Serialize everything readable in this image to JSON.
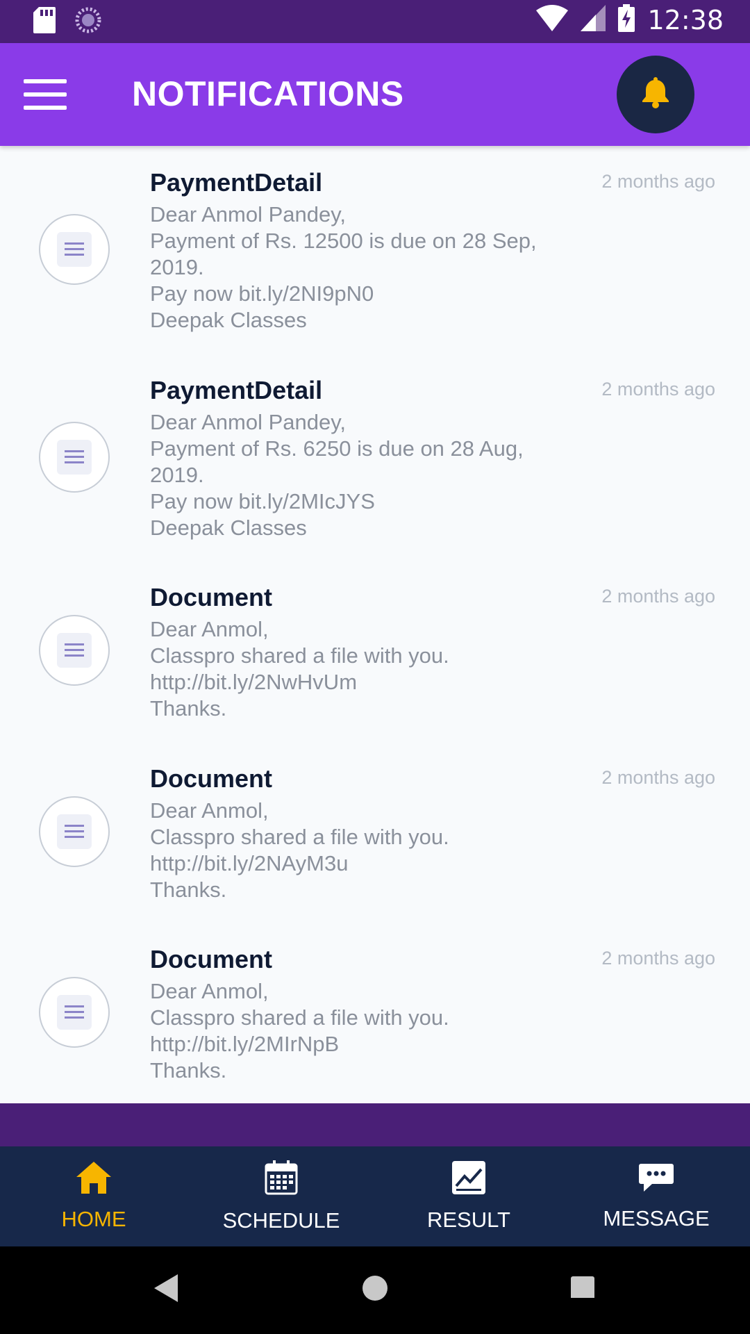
{
  "status_bar": {
    "time": "12:38"
  },
  "app_bar": {
    "title": "NOTIFICATIONS"
  },
  "notifications": [
    {
      "title": "PaymentDetail",
      "time": "2 months ago",
      "body": "Dear Anmol Pandey,\nPayment of Rs. 12500 is due on 28 Sep,\n2019.\nPay now bit.ly/2NI9pN0\nDeepak Classes"
    },
    {
      "title": "PaymentDetail",
      "time": "2 months ago",
      "body": "Dear Anmol Pandey,\nPayment of Rs. 6250 is due on 28 Aug,\n2019.\nPay now bit.ly/2MIcJYS\nDeepak Classes"
    },
    {
      "title": "Document",
      "time": "2 months ago",
      "body": "Dear Anmol,\nClasspro shared a file with you.\nhttp://bit.ly/2NwHvUm\nThanks."
    },
    {
      "title": "Document",
      "time": "2 months ago",
      "body": "Dear Anmol,\nClasspro shared a file with you.\nhttp://bit.ly/2NAyM3u\nThanks."
    },
    {
      "title": "Document",
      "time": "2 months ago",
      "body": "Dear Anmol,\nClasspro shared a file with you.\nhttp://bit.ly/2MIrNpB\nThanks."
    }
  ],
  "bottom_nav": [
    {
      "label": "HOME",
      "icon": "home-icon",
      "active": true
    },
    {
      "label": "SCHEDULE",
      "icon": "calendar-icon",
      "active": false
    },
    {
      "label": "RESULT",
      "icon": "chart-icon",
      "active": false
    },
    {
      "label": "MESSAGE",
      "icon": "message-icon",
      "active": false
    }
  ],
  "colors": {
    "status_bar": "#4a1f77",
    "app_bar": "#8a3be8",
    "bell_bg": "#1a2744",
    "bell": "#f7b500",
    "nav_bg": "#17284a",
    "nav_active": "#f7b500"
  }
}
